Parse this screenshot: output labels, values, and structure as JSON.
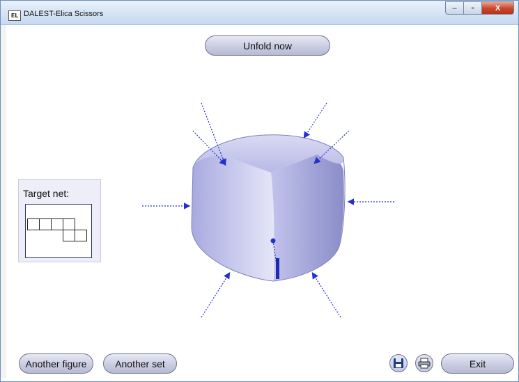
{
  "window": {
    "title": "DALEST-Elica Scissors",
    "app_icon_text": "EL",
    "minimize_glyph": "–",
    "maximize_glyph": "▫",
    "close_glyph": "X"
  },
  "toolbar": {
    "unfold_label": "Unfold now"
  },
  "target_net": {
    "label": "Target net:"
  },
  "bottom": {
    "another_figure_label": "Another figure",
    "another_set_label": "Another set",
    "exit_label": "Exit"
  },
  "icons": {
    "save": "floppy-disk-icon",
    "print": "printer-icon",
    "scissors": "scissors-icon"
  },
  "colors": {
    "cube_light": "#dfe0f6",
    "cube_dark": "#8487c4",
    "arrow_blue": "#2231cc"
  }
}
